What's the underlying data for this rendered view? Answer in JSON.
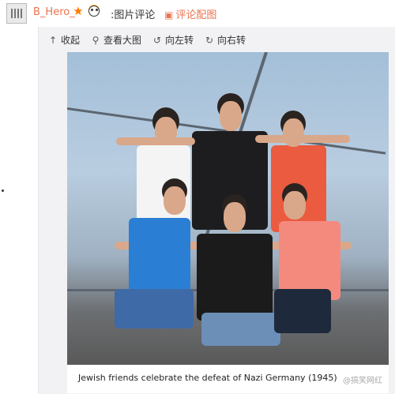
{
  "header": {
    "username": "B_Hero_",
    "badges": [
      "star-icon",
      "emoji-face-icon",
      "panda-icon"
    ],
    "title": ":图片评论",
    "comment_pic_label": "评论配图"
  },
  "toolbar": {
    "collect": "收起",
    "view_large": "查看大图",
    "rotate_left": "向左转",
    "rotate_right": "向右转"
  },
  "photo": {
    "caption": "Jewish friends celebrate the defeat of Nazi Germany (1945)",
    "watermark": "@搞笑网红"
  },
  "colors": {
    "accent": "#eb7350",
    "viewer_bg": "#f2f2f5"
  }
}
